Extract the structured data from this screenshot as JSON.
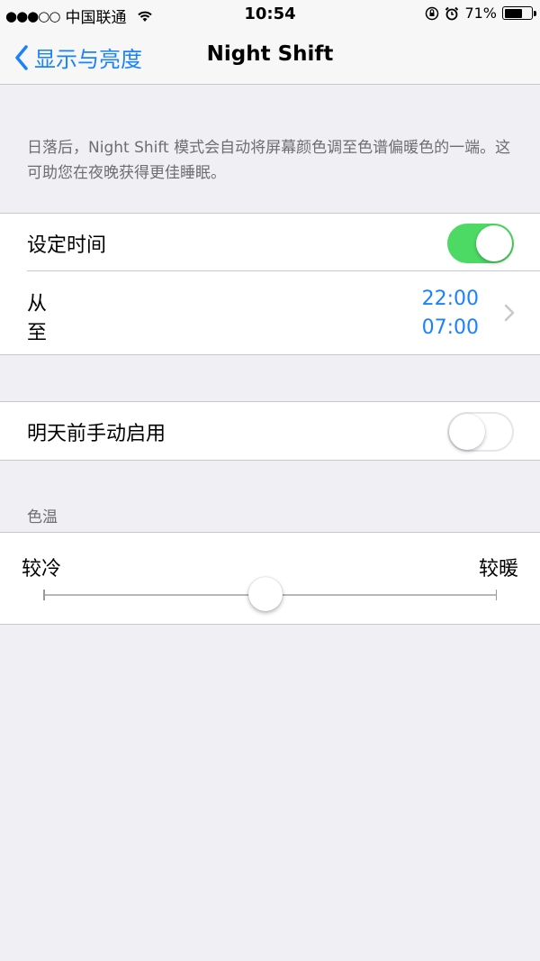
{
  "status_bar": {
    "signal": "●●●○○",
    "carrier": "中国联通",
    "time": "10:54",
    "battery_percent": "71%",
    "battery_level": 0.71
  },
  "nav": {
    "back_label": "显示与亮度",
    "title": "Night Shift"
  },
  "description": "日落后，Night Shift 模式会自动将屏幕颜色调至色谱偏暖色的一端。这可助您在夜晚获得更佳睡眠。",
  "schedule": {
    "label": "设定时间",
    "enabled": true,
    "from_label": "从",
    "to_label": "至",
    "from_time": "22:00",
    "to_time": "07:00"
  },
  "manual": {
    "label": "明天前手动启用",
    "enabled": false
  },
  "color_temperature": {
    "header": "色温",
    "left_label": "较冷",
    "right_label": "较暖",
    "value": 0.49
  },
  "colors": {
    "accent": "#1a82fb",
    "toggle_on": "#4cd964",
    "background": "#efeff4"
  }
}
